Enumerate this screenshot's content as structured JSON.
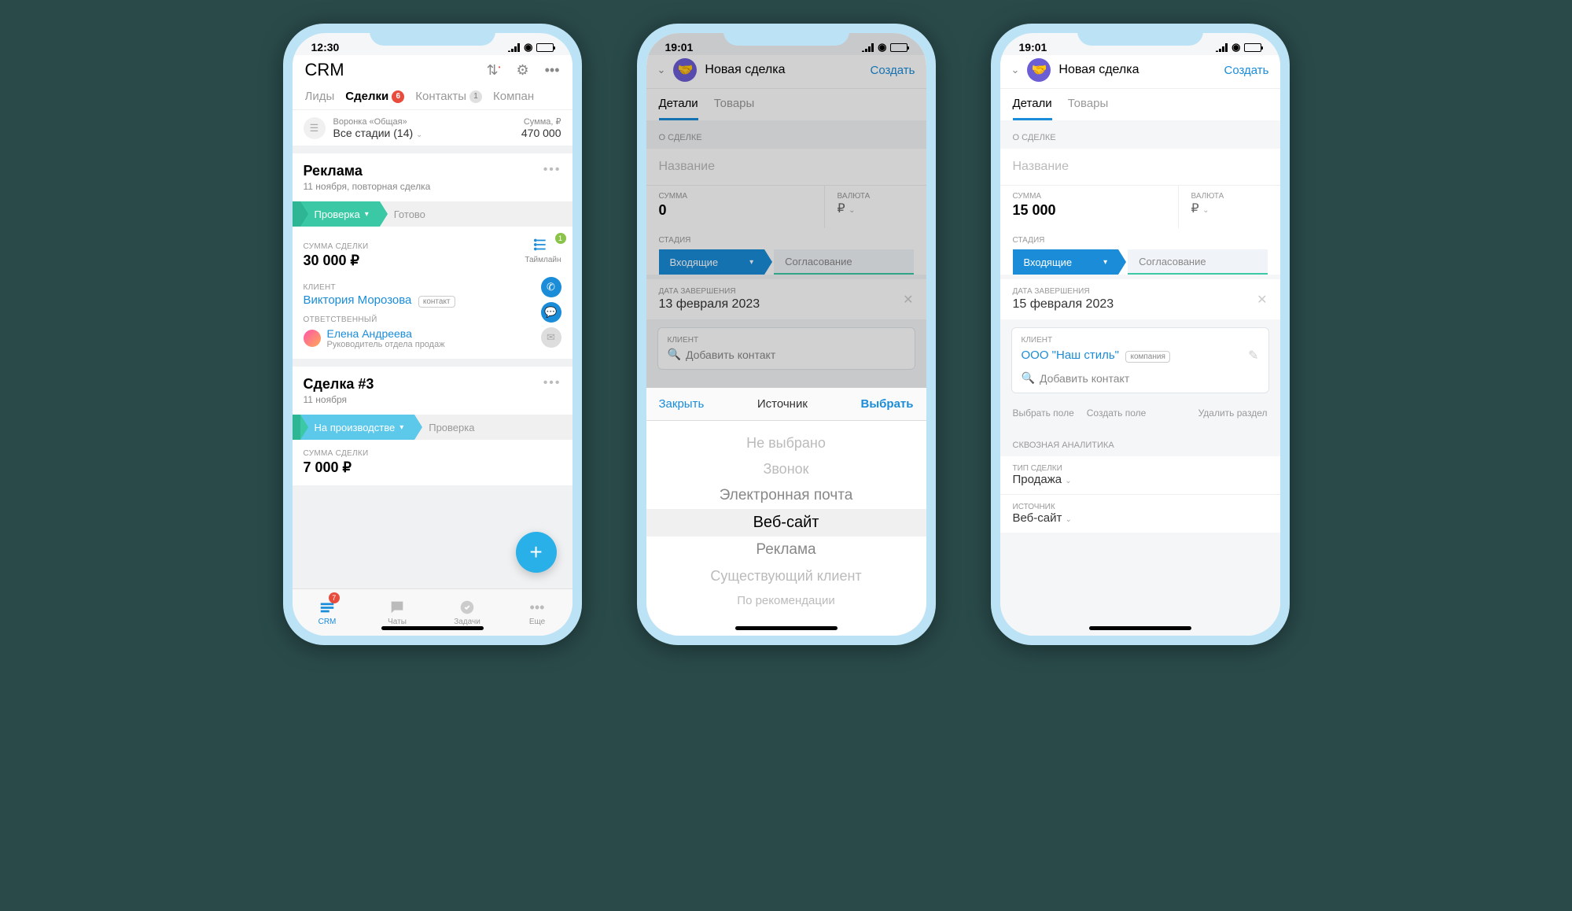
{
  "s1": {
    "time": "12:30",
    "battery_color": "#ffc107",
    "title": "CRM",
    "tabs": [
      {
        "label": "Лиды"
      },
      {
        "label": "Сделки",
        "badge": "6",
        "badge_red": true,
        "active": true
      },
      {
        "label": "Контакты",
        "badge": "1"
      },
      {
        "label": "Компан"
      }
    ],
    "funnel": {
      "label": "Воронка «Общая»",
      "value": "Все стадии (14)"
    },
    "sum": {
      "label": "Сумма, ₽",
      "value": "470 000"
    },
    "deal1": {
      "title": "Реклама",
      "sub": "11 ноября, повторная сделка",
      "stage_current": "Проверка",
      "stage_next": "Готово",
      "amount_label": "СУММА СДЕЛКИ",
      "amount": "30 000 ₽",
      "timeline_label": "Таймлайн",
      "timeline_badge": "1",
      "client_label": "КЛИЕНТ",
      "client": "Виктория Морозова",
      "client_tag": "контакт",
      "resp_label": "ОТВЕТСТВЕННЫЙ",
      "resp_name": "Елена Андреева",
      "resp_role": "Руководитель отдела продаж"
    },
    "deal2": {
      "title": "Сделка #3",
      "sub": "11 ноября",
      "stage_current": "На производстве",
      "stage_next": "Проверка",
      "amount_label": "СУММА СДЕЛКИ",
      "amount": "7 000 ₽"
    },
    "tabbar": {
      "crm": "CRM",
      "crm_badge": "7",
      "chats": "Чаты",
      "tasks": "Задачи",
      "more": "Еще"
    }
  },
  "s2": {
    "time": "19:01",
    "battery_color": "#8bc34a",
    "header": "Новая сделка",
    "action": "Создать",
    "tab_details": "Детали",
    "tab_goods": "Товары",
    "sec_about": "О СДЕЛКЕ",
    "name_ph": "Название",
    "sum_label": "СУММА",
    "sum_val": "0",
    "cur_label": "ВАЛЮТА",
    "cur_val": "₽",
    "stage_label": "СТАДИЯ",
    "stage_current": "Входящие",
    "stage_next": "Согласование",
    "date_label": "ДАТА ЗАВЕРШЕНИЯ",
    "date_val": "13 февраля 2023",
    "client_label": "КЛИЕНТ",
    "add_contact": "Добавить контакт",
    "picker": {
      "close": "Закрыть",
      "title": "Источник",
      "select": "Выбрать",
      "options": [
        "Не выбрано",
        "Звонок",
        "Электронная почта",
        "Веб-сайт",
        "Реклама",
        "Существующий клиент",
        "По рекомендации"
      ],
      "selected_index": 3
    }
  },
  "s3": {
    "time": "19:01",
    "battery_color": "#8bc34a",
    "header": "Новая сделка",
    "action": "Создать",
    "tab_details": "Детали",
    "tab_goods": "Товары",
    "sec_about": "О СДЕЛКЕ",
    "name_ph": "Название",
    "sum_label": "СУММА",
    "sum_val": "15 000",
    "cur_label": "ВАЛЮТА",
    "cur_val": "₽",
    "stage_label": "СТАДИЯ",
    "stage_current": "Входящие",
    "stage_next": "Согласование",
    "date_label": "ДАТА ЗАВЕРШЕНИЯ",
    "date_val": "15 февраля 2023",
    "client_label": "КЛИЕНТ",
    "client_name": "ООО \"Наш стиль\"",
    "client_tag": "компания",
    "add_contact": "Добавить контакт",
    "act_select": "Выбрать поле",
    "act_create": "Создать поле",
    "act_delete": "Удалить раздел",
    "sec_analytics": "СКВОЗНАЯ АНАЛИТИКА",
    "type_label": "ТИП СДЕЛКИ",
    "type_val": "Продажа",
    "src_label": "ИСТОЧНИК",
    "src_val": "Веб-сайт"
  }
}
